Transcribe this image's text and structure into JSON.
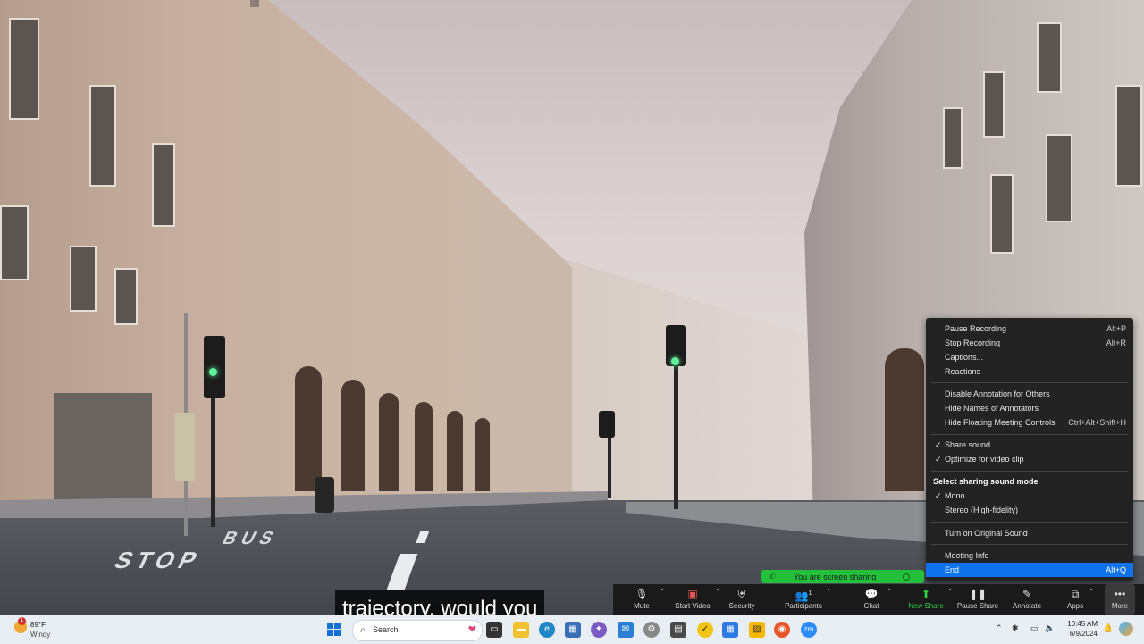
{
  "caption": {
    "text": "trajectory, would you"
  },
  "sharing_indicator": {
    "label": "You are screen sharing"
  },
  "more_menu": {
    "items": [
      {
        "label": "Pause Recording",
        "shortcut": "Alt+P"
      },
      {
        "label": "Stop Recording",
        "shortcut": "Alt+R"
      },
      {
        "label": "Captions...",
        "shortcut": ""
      },
      {
        "label": "Reactions",
        "shortcut": ""
      },
      {
        "label": "Disable Annotation for Others",
        "shortcut": ""
      },
      {
        "label": "Hide Names of Annotators",
        "shortcut": ""
      },
      {
        "label": "Hide Floating Meeting Controls",
        "shortcut": "Ctrl+Alt+Shift+H"
      },
      {
        "label": "Share sound",
        "checked": true
      },
      {
        "label": "Optimize for video clip",
        "checked": true
      },
      {
        "label": "Select sharing sound mode"
      },
      {
        "label": "Mono",
        "checked": true
      },
      {
        "label": "Stereo (High-fidelity)"
      },
      {
        "label": "Turn on Original Sound"
      },
      {
        "label": "Meeting Info"
      },
      {
        "label": "End",
        "shortcut": "Alt+Q",
        "selected": true
      }
    ]
  },
  "toolbar": {
    "buttons": [
      {
        "label": "Mute",
        "icon": "microphone-icon"
      },
      {
        "label": "Start Video",
        "icon": "video-off-icon"
      },
      {
        "label": "Security",
        "icon": "shield-icon"
      },
      {
        "label": "Participants",
        "icon": "participants-icon",
        "count": "1"
      },
      {
        "label": "Chat",
        "icon": "chat-icon"
      },
      {
        "label": "New Share",
        "icon": "share-icon"
      },
      {
        "label": "Pause Share",
        "icon": "pause-icon"
      },
      {
        "label": "Annotate",
        "icon": "pen-icon"
      },
      {
        "label": "Apps",
        "icon": "apps-icon"
      },
      {
        "label": "More",
        "icon": "more-icon"
      }
    ],
    "accent_color": "#2fce45"
  },
  "taskbar": {
    "weather": {
      "badge": "1",
      "temp": "89°F",
      "condition": "Windy"
    },
    "search_placeholder": "Search",
    "clock": {
      "time": "10:45 AM",
      "date": "6/9/2024"
    }
  },
  "scene": {
    "road_text_1": "BUS",
    "road_text_2": "STOP"
  }
}
